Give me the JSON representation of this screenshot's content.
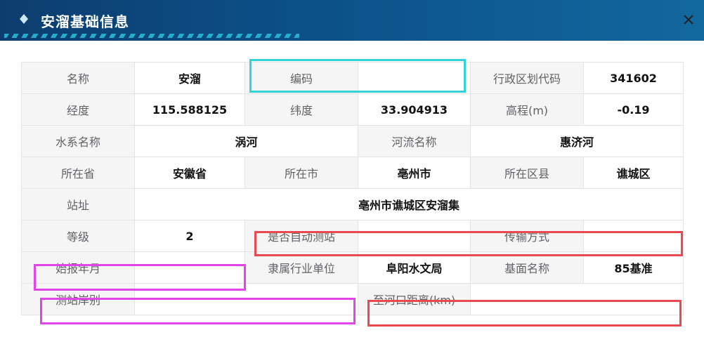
{
  "dialog": {
    "title": "安溜基础信息",
    "colors": {
      "header": "#0b4f86",
      "accent": "#2ec6e0"
    },
    "close_icon": "close-icon"
  },
  "table": {
    "rows": [
      [
        {
          "label": "名称",
          "value": "安溜"
        },
        {
          "label": "编码",
          "value": ""
        },
        {
          "label": "行政区划代码",
          "value": "341602"
        }
      ],
      [
        {
          "label": "经度",
          "value": "115.588125"
        },
        {
          "label": "纬度",
          "value": "33.904913"
        },
        {
          "label": "高程(m)",
          "value": "-0.19"
        }
      ],
      [
        {
          "label": "水系名称",
          "value": "涡河"
        },
        {
          "label": "河流名称",
          "value": "惠济河"
        }
      ],
      [
        {
          "label": "所在省",
          "value": "安徽省"
        },
        {
          "label": "所在市",
          "value": "亳州市"
        },
        {
          "label": "所在区县",
          "value": "谯城区"
        }
      ],
      [
        {
          "label": "站址",
          "value": "亳州市谯城区安溜集"
        }
      ],
      [
        {
          "label": "等级",
          "value": "2"
        },
        {
          "label": "是否自动测站",
          "value": ""
        },
        {
          "label": "传输方式",
          "value": ""
        }
      ],
      [
        {
          "label": "始报年月",
          "value": ""
        },
        {
          "label": "隶属行业单位",
          "value": "阜阳水文局"
        },
        {
          "label": "基面名称",
          "value": "85基准"
        }
      ],
      [
        {
          "label": "测站岸别",
          "value": ""
        },
        {
          "label": "至河口距离(km)",
          "value": ""
        }
      ]
    ]
  },
  "highlights": {
    "cyan": "#33d3db",
    "red": "#ea4a4f",
    "magenta": "#e344e8"
  }
}
